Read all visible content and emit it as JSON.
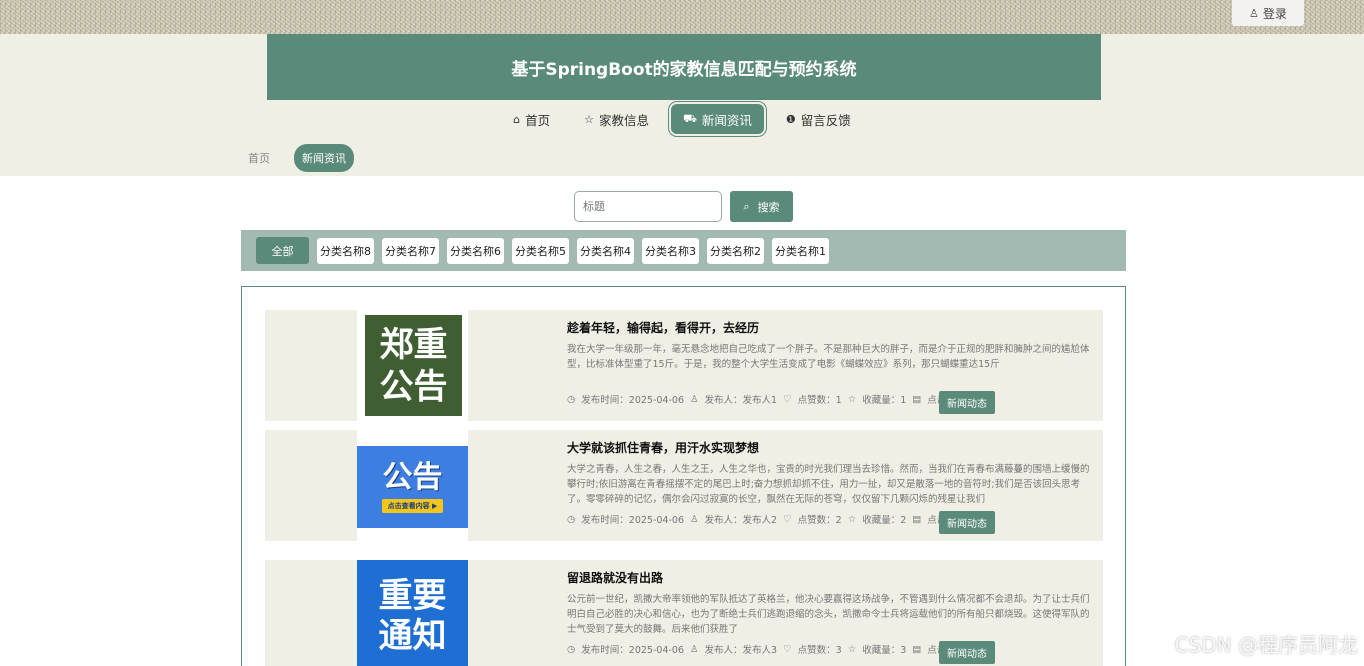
{
  "topbar": {
    "login_icon": "user-icon",
    "login_label": "登录"
  },
  "header": {
    "title": "基于SpringBoot的家教信息匹配与预约系统"
  },
  "nav": {
    "items": [
      {
        "icon": "home-icon",
        "label": "首页",
        "active": false
      },
      {
        "icon": "star-icon",
        "label": "家教信息",
        "active": false
      },
      {
        "icon": "bag-icon",
        "label": "新闻资讯",
        "active": true
      },
      {
        "icon": "info-icon",
        "label": "留言反馈",
        "active": false
      }
    ]
  },
  "breadcrumb": {
    "home": "首页",
    "current": "新闻资讯"
  },
  "search": {
    "placeholder": "标题",
    "button_label": "搜索"
  },
  "categories": {
    "all_label": "全部",
    "items": [
      "分类名称8",
      "分类名称7",
      "分类名称6",
      "分类名称5",
      "分类名称4",
      "分类名称3",
      "分类名称2",
      "分类名称1"
    ]
  },
  "news": [
    {
      "title": "趁着年轻，输得起，看得开，去经历",
      "desc": "我在大学一年级那一年，毫无悬念地把自己吃成了一个胖子。不是那种巨大的胖子，而是介于正规的肥胖和臃肿之间的尴尬体型，比标准体型重了15斤。于是，我的整个大学生活变成了电影《蝴蝶效应》系列，那只蝴蝶重达15斤",
      "time_label": "发布时间：2025-04-06",
      "author_label": "发布人：发布人1",
      "likes_label": "点赞数：1",
      "favs_label": "收藏量：1",
      "clicks_label": "点击量：1",
      "tag": "新闻动态",
      "thumb": {
        "line1": "郑重",
        "line2": "公告",
        "bg": "#3f5e32"
      }
    },
    {
      "title": "大学就该抓住青春，用汗水实现梦想",
      "desc": "大学之青春，人生之春，人生之王，人生之华也，宝贵的时光我们理当去珍惜。然而，当我们在青春布满藤蔓的围墙上缓慢的攀行时;依旧游离在青春摇摆不定的尾巴上时;奋力想抓却抓不住，用力一扯，却又是散落一地的音符时;我们是否该回头思考了。零零碎碎的记忆，偶尔会闪过寂寞的长空，飘然在无际的苍穹，仅仅留下几颗闪烁的残星让我们",
      "time_label": "发布时间：2025-04-06",
      "author_label": "发布人：发布人2",
      "likes_label": "点赞数：2",
      "favs_label": "收藏量：2",
      "clicks_label": "点击量：2",
      "tag": "新闻动态",
      "thumb": {
        "line1": "公告",
        "line2": "点击查看内容 ▶",
        "bg": "#3d7fe0"
      }
    },
    {
      "title": "留退路就没有出路",
      "desc": "公元前一世纪，凯撒大帝率领他的军队抵达了英格兰，他决心要赢得这场战争，不管遇到什么情况都不会退却。为了让士兵们明白自己必胜的决心和信心，也为了断绝士兵们逃跑退缩的念头，凯撒命令士兵将运载他们的所有船只都烧毁。这使得军队的士气受到了莫大的鼓舞。后来他们获胜了",
      "time_label": "发布时间：2025-04-06",
      "author_label": "发布人：发布人3",
      "likes_label": "点赞数：3",
      "favs_label": "收藏量：3",
      "clicks_label": "点击量：3",
      "tag": "新闻动态",
      "thumb": {
        "line1": "重要",
        "line2": "通知",
        "bg": "#1f6ed4"
      }
    }
  ],
  "watermark": "CSDN @程序员阿龙",
  "colors": {
    "primary": "#5a8a7a",
    "header_bg": "#efefe6",
    "category_bar": "#a2bab1"
  }
}
